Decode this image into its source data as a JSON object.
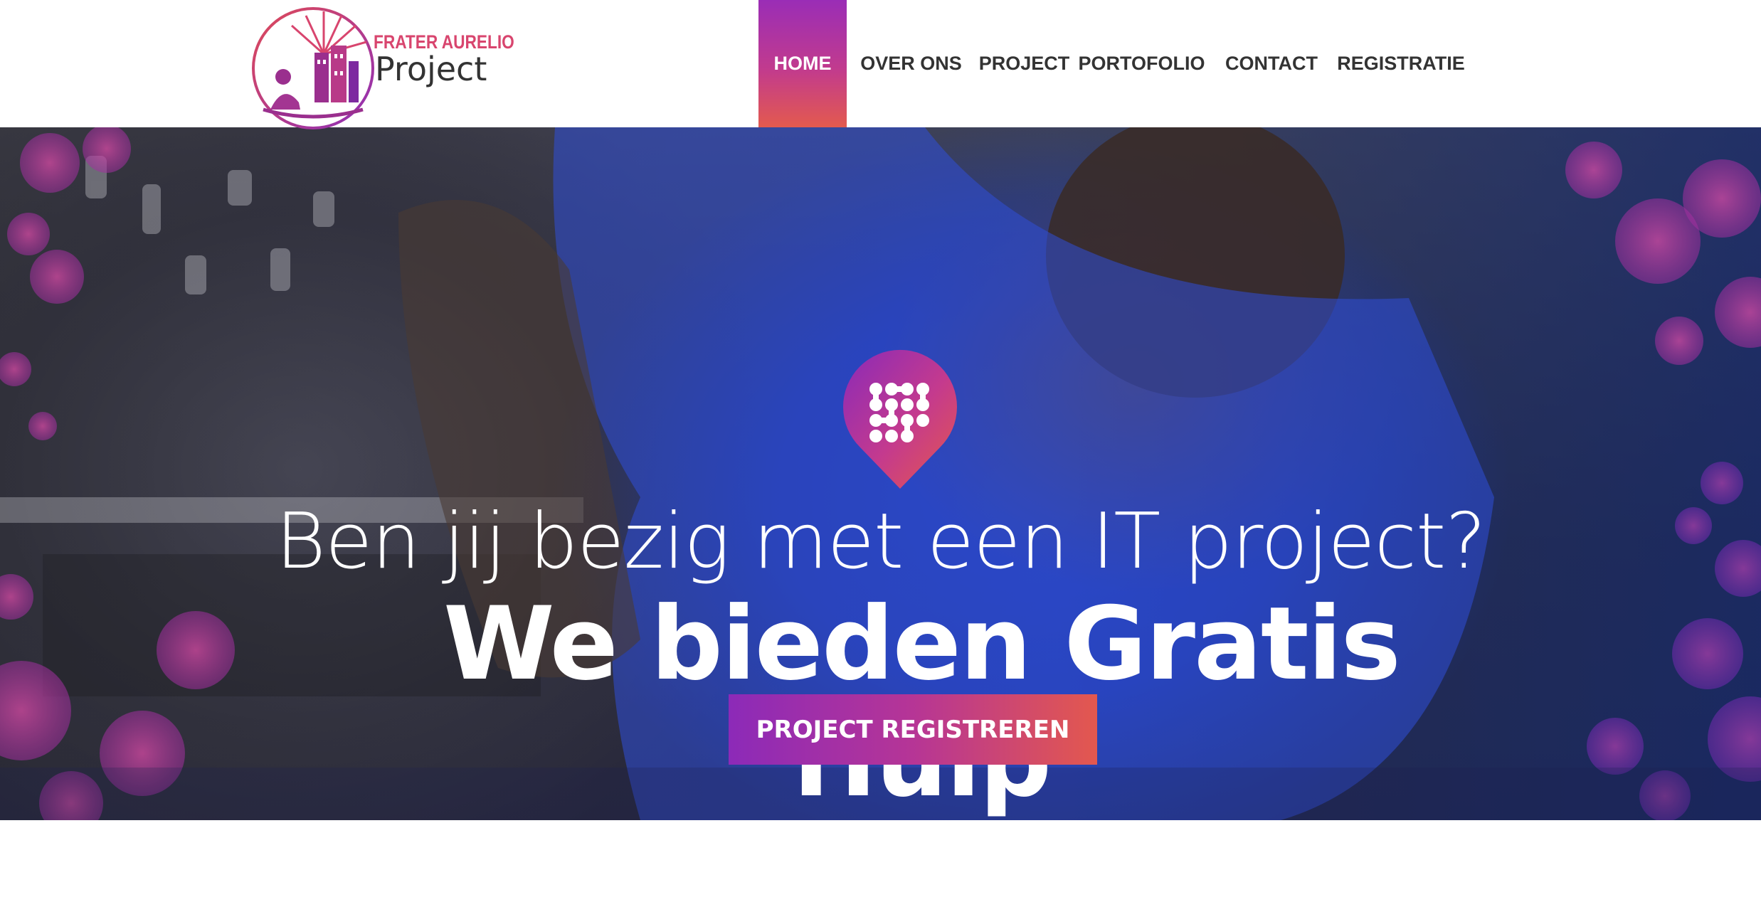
{
  "header": {
    "logo": {
      "title": "FRATER AURELIO",
      "subtitle": "Project",
      "badge_text": "FRATER AURELIO"
    },
    "nav": [
      {
        "label": "HOME",
        "active": true
      },
      {
        "label": "OVER ONS",
        "active": false
      },
      {
        "label": "PROJECT",
        "active": false
      },
      {
        "label": "PORTOFOLIO",
        "active": false
      },
      {
        "label": "CONTACT",
        "active": false
      },
      {
        "label": "REGISTRATIE",
        "active": false
      }
    ]
  },
  "hero": {
    "icon": "map-pin-dots-icon",
    "headline": "Ben jij bezig met een IT project?",
    "subheadline": "We bieden Gratis Hulp",
    "cta_label": "PROJECT REGISTREREN"
  },
  "colors": {
    "accent_purple": "#8c2ab8",
    "accent_magenta": "#c23b8d",
    "accent_orange": "#e3584e",
    "nav_text": "#333333",
    "hero_text": "#ffffff"
  }
}
